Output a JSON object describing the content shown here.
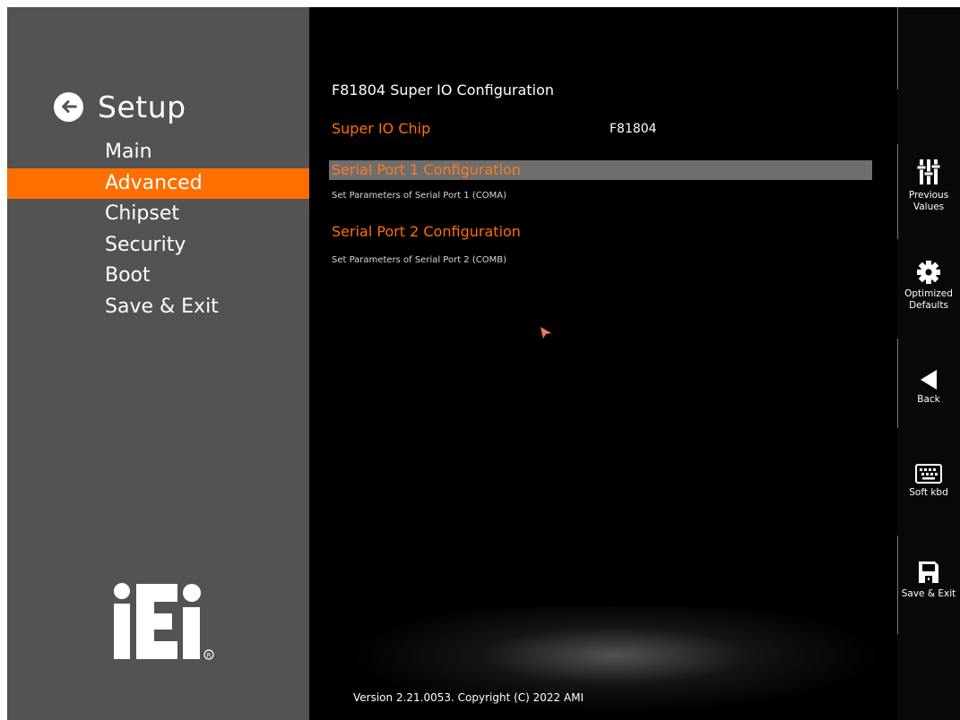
{
  "sidebar": {
    "title": "Setup",
    "menu": [
      "Main",
      "Advanced",
      "Chipset",
      "Security",
      "Boot",
      "Save & Exit"
    ],
    "active_index": 1,
    "accent_color": "#ff6f00"
  },
  "main": {
    "heading": "F81804 Super IO Configuration",
    "chip_label": "Super IO Chip",
    "chip_value": "F81804",
    "items": [
      {
        "label": "Serial Port 1 Configuration",
        "help": "Set Parameters of Serial Port 1 (COMA)",
        "selected": true
      },
      {
        "label": "Serial Port 2 Configuration",
        "help": "Set Parameters of Serial Port 2 (COMB)",
        "selected": false
      }
    ],
    "version": "Version 2.21.0053. Copyright (C) 2022 AMI"
  },
  "toolbar": {
    "previous_values": "Previous Values",
    "optimized_defaults": "Optimized Defaults",
    "back": "Back",
    "soft_kbd": "Soft kbd",
    "save_exit": "Save & Exit"
  },
  "logo_text": "iEi",
  "icons": [
    "back-arrow-icon",
    "sliders-icon",
    "gear-icon",
    "triangle-back-icon",
    "keyboard-icon",
    "floppy-save-icon",
    "mouse-cursor-icon"
  ]
}
